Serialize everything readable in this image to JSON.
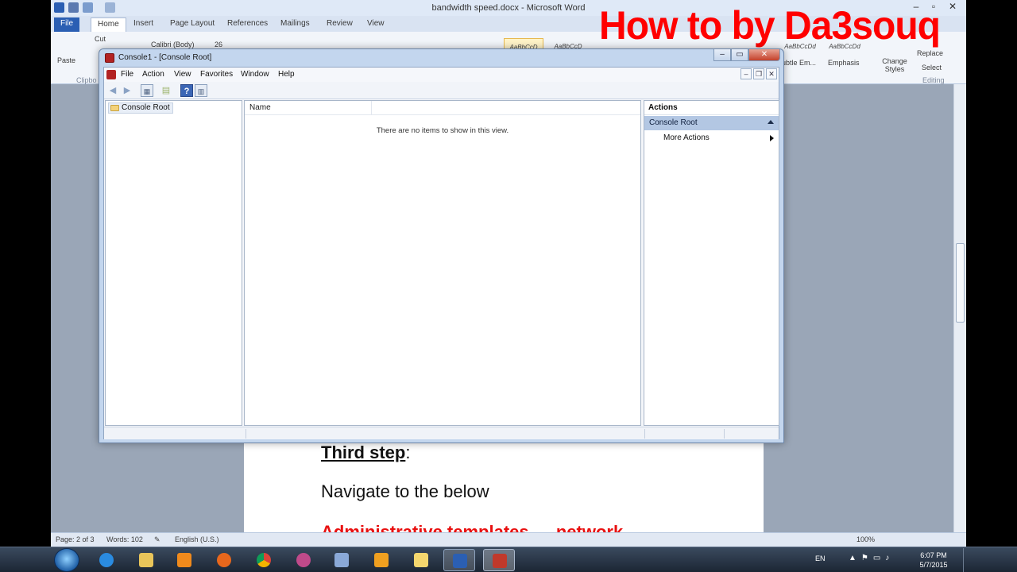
{
  "overlay": {
    "title": "How to by Da3souq"
  },
  "word": {
    "window_title": "bandwidth speed.docx - Microsoft Word",
    "tabs": [
      "File",
      "Home",
      "Insert",
      "Page Layout",
      "References",
      "Mailings",
      "Review",
      "View"
    ],
    "ribbon": {
      "paste": "Paste",
      "cut": "Cut",
      "clipboard": "Clipbo",
      "font": "Calibri (Body)",
      "font_size": "26",
      "styles": [
        "AaBbCcD",
        "AaBbCcD",
        "AaBbCcDd",
        "AaBbCcDd"
      ],
      "subtle_em": "ubtle Em...",
      "emphasis": "Emphasis",
      "change_styles": "Change Styles",
      "replace": "Replace",
      "select": "Select",
      "editing": "Editing"
    },
    "status": {
      "page": "Page: 2 of 3",
      "words": "Words: 102",
      "language": "English (U.S.)",
      "zoom": "100%"
    },
    "doc": {
      "heading_strong": "Third step",
      "heading_rest": ":",
      "line": "Navigate to the below",
      "red_line": "Administrative templates → network"
    }
  },
  "mmc": {
    "title": "Console1 - [Console Root]",
    "menu": [
      "File",
      "Action",
      "View",
      "Favorites",
      "Window",
      "Help"
    ],
    "tree_root": "Console Root",
    "list_col_name": "Name",
    "empty_message": "There are no items to show in this view.",
    "actions_header": "Actions",
    "actions_section": "Console Root",
    "actions_more": "More Actions"
  },
  "taskbar": {
    "language": "EN",
    "time": "6:07 PM",
    "date": "5/7/2015"
  },
  "colors": {
    "overlay_red": "#ff0000",
    "word_file_tab": "#2b5fb3",
    "actions_section_bg": "#b3c7e3"
  }
}
